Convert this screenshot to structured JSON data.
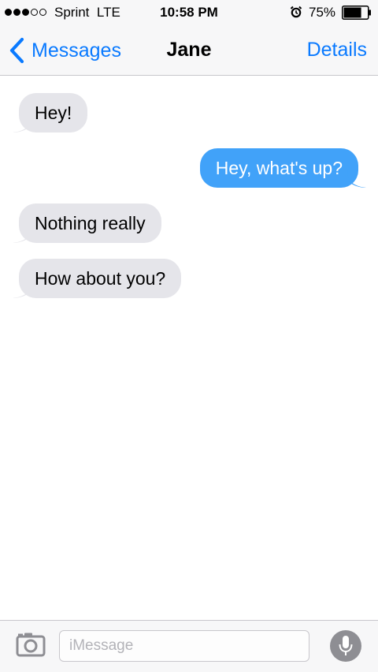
{
  "status_bar": {
    "carrier": "Sprint",
    "network": "LTE",
    "time": "10:58 PM",
    "battery": "75%",
    "battery_level": 0.75,
    "signal_strength": 3,
    "signal_max": 5
  },
  "nav": {
    "back_label": "Messages",
    "title": "Jane",
    "details_label": "Details"
  },
  "messages": [
    {
      "text": "Hey!",
      "direction": "received"
    },
    {
      "text": "Hey, what's up?",
      "direction": "sent"
    },
    {
      "text": "Nothing really",
      "direction": "received"
    },
    {
      "text": "How about you?",
      "direction": "received"
    }
  ],
  "input": {
    "placeholder": "iMessage",
    "value": ""
  },
  "colors": {
    "accent": "#0a7aff",
    "sent_bubble": "#41a2f9",
    "received_bubble": "#e5e5ea",
    "bar_background": "#f7f7f8"
  },
  "icons": {
    "back": "chevron-left-icon",
    "alarm": "alarm-clock-icon",
    "battery": "battery-icon",
    "camera": "camera-icon",
    "microphone": "microphone-icon"
  }
}
